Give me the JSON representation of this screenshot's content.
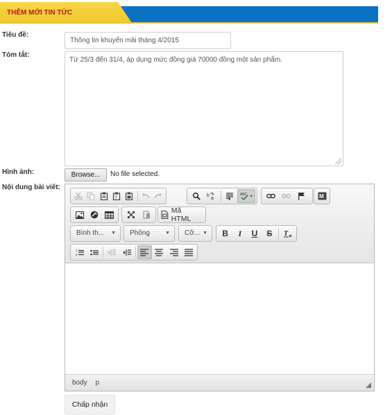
{
  "header": {
    "title": "THÊM MỚI TIN TỨC",
    "accent": "#f0c92c",
    "bar_color": "#0b72c3",
    "title_color": "#b21a1a"
  },
  "form": {
    "title_label": "Tiêu đề:",
    "title_value": "Thông tin khuyến mãi tháng 4/2015",
    "summary_label": "Tóm tắt:",
    "summary_value": "Từ 25/3 đến 31/4, áp dụng mức đồng giá 70000 đồng một sản phẩm.",
    "image_label": "Hình ảnh:",
    "browse_label": "Browse...",
    "file_status": "No file selected.",
    "content_label": "Nội dung bài viết:"
  },
  "editor": {
    "source_label": "Mã HTML",
    "format_combo": "Bình th...",
    "font_combo": "Phông",
    "size_combo": "Cỡ...",
    "path": [
      "body",
      "p"
    ],
    "toolbar_icons": {
      "row1": [
        "cut-icon",
        "copy-icon",
        "paste-icon",
        "paste-text-icon",
        "paste-word-icon",
        "undo-icon",
        "redo-icon",
        "find-icon",
        "replace-icon",
        "select-all-icon",
        "spellcheck-icon",
        "link-icon",
        "unlink-icon",
        "anchor-icon",
        "flash-icon"
      ],
      "row2": [
        "image-icon",
        "special-char-icon",
        "table-icon",
        "maximize-icon",
        "show-blocks-icon",
        "source-icon"
      ],
      "row3": [
        "bold-icon",
        "italic-icon",
        "underline-icon",
        "strike-icon",
        "remove-format-icon"
      ],
      "row4": [
        "numbered-list-icon",
        "bulleted-list-icon",
        "outdent-icon",
        "indent-icon",
        "align-left-icon",
        "align-center-icon",
        "align-right-icon",
        "justify-icon"
      ]
    }
  },
  "submit_label": "Chấp nhận"
}
